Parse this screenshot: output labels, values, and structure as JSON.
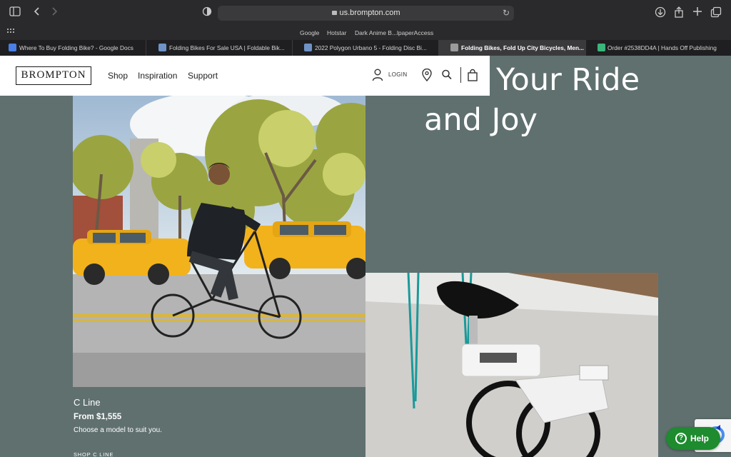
{
  "browser": {
    "url": "us.brompton.com",
    "favorites": [
      "Google",
      "Hotstar",
      "Dark Anime B...lpaperAccess"
    ],
    "tabs": [
      {
        "label": "Where To Buy Folding Bike? - Google Docs",
        "icon_color": "#4a7fe6"
      },
      {
        "label": "Folding Bikes For Sale USA | Foldable Bik...",
        "icon_color": "#6f93c7"
      },
      {
        "label": "2022 Polygon Urbano 5 - Folding Disc Bi...",
        "icon_color": "#6f93c7"
      },
      {
        "label": "Folding Bikes, Fold Up City Bicycles, Men...",
        "icon_color": "#9b9b9b",
        "active": true
      },
      {
        "label": "Order #2538DD4A | Hands Off Publishing",
        "icon_color": "#3bb57b"
      }
    ]
  },
  "header": {
    "logo": "BROMPTON",
    "nav": [
      "Shop",
      "Inspiration",
      "Support"
    ],
    "login_label": "LOGIN"
  },
  "hero": {
    "title_line1": "Your Ride",
    "title_line2": "and Joy"
  },
  "product": {
    "name": "C Line",
    "price": "From $1,555",
    "description": "Choose a model to suit you.",
    "cta": "SHOP C LINE"
  },
  "help": {
    "label": "Help"
  },
  "colors": {
    "background": "#5f706f",
    "help_green": "#1d8b2e"
  }
}
